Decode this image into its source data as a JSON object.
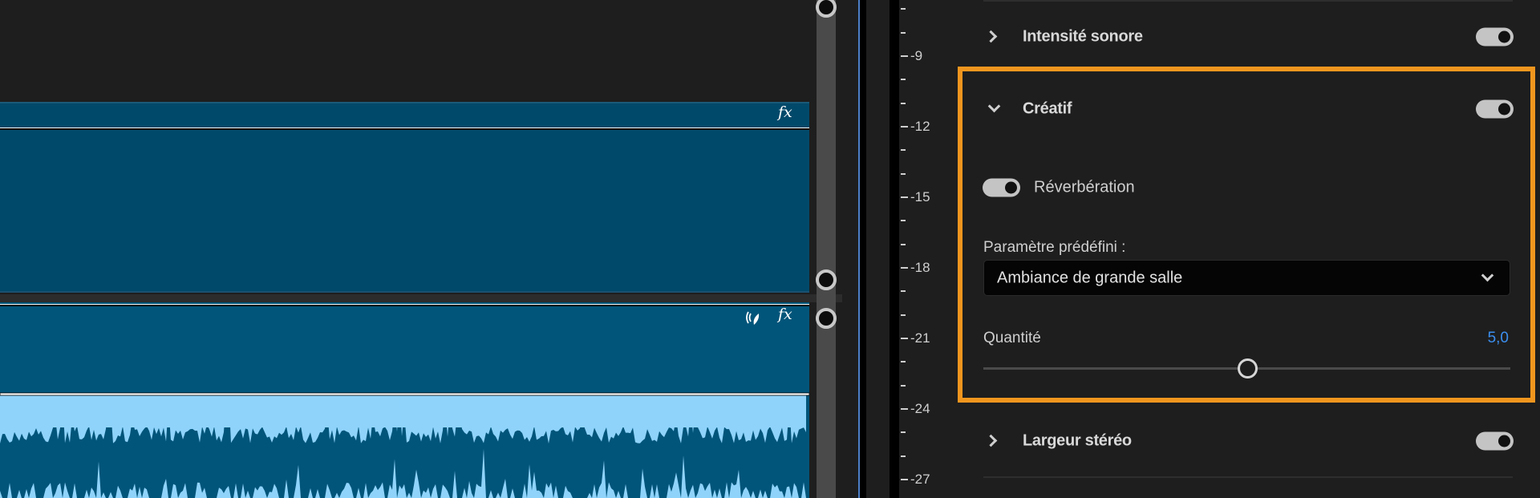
{
  "timeline": {
    "clip1": {
      "fx_label": "fx"
    },
    "clip2": {
      "fx_label": "fx",
      "icons": [
        "voice-enhance-icon",
        "fx-icon"
      ]
    }
  },
  "meter": {
    "ticks": [
      "-9",
      "-12",
      "-15",
      "-18",
      "-21",
      "-24",
      "-27"
    ]
  },
  "panel": {
    "sections": [
      {
        "label": "Intensité sonore",
        "expanded": false,
        "enabled": true
      },
      {
        "label": "Créatif",
        "expanded": true,
        "enabled": true
      },
      {
        "label": "Largeur stéréo",
        "expanded": false,
        "enabled": true
      }
    ],
    "creative": {
      "reverb_label": "Réverbération",
      "reverb_enabled": true,
      "preset_label": "Paramètre prédéfini :",
      "preset_value": "Ambiance de grande salle",
      "amount_label": "Quantité",
      "amount_value": "5,0",
      "amount_fraction": 0.5
    }
  },
  "colors": {
    "highlight": "#f0961e",
    "accent": "#3b8ff0",
    "clip": "#02557a",
    "waveform": "#8fd3fb"
  }
}
